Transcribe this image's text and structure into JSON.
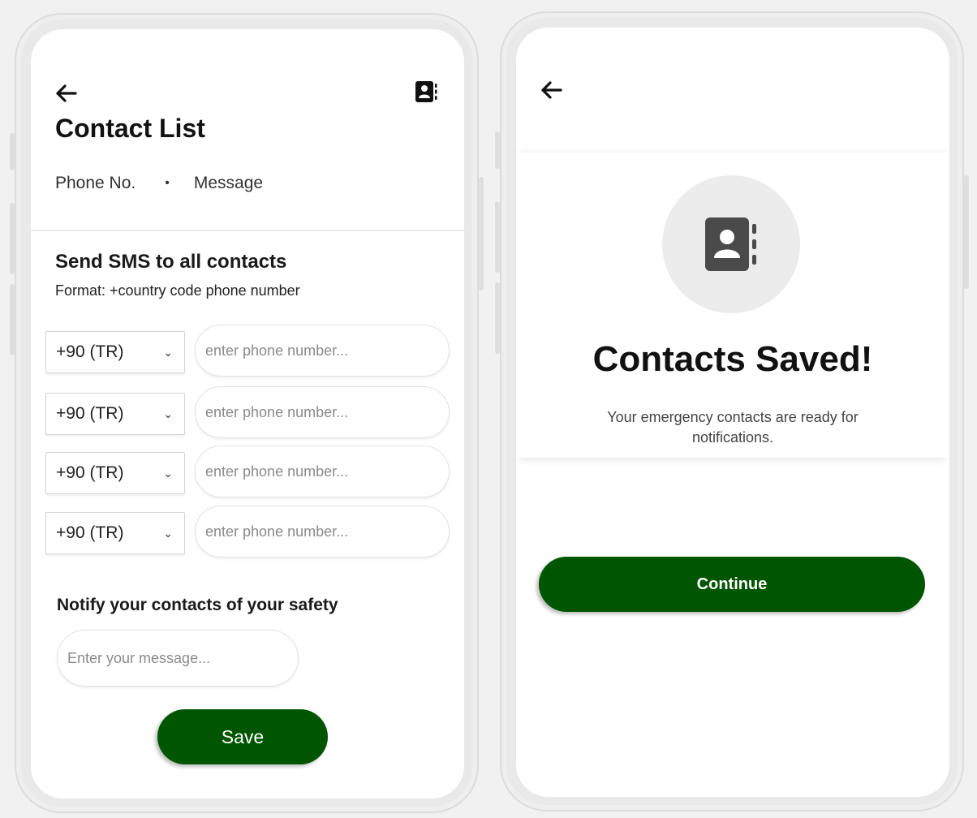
{
  "contact_list": {
    "title": "Contact List",
    "tabs": [
      "Phone No.",
      "Message"
    ],
    "tab_separator": "•",
    "section_title": "Send SMS to all contacts",
    "section_subtitle": "Format: +country code phone number",
    "rows": [
      {
        "country_code": "+90 (TR)",
        "phone_placeholder": "enter phone number..."
      },
      {
        "country_code": "+90 (TR)",
        "phone_placeholder": "enter phone number..."
      },
      {
        "country_code": "+90 (TR)",
        "phone_placeholder": "enter phone number..."
      },
      {
        "country_code": "+90 (TR)",
        "phone_placeholder": "enter phone number..."
      }
    ],
    "notify_title": "Notify your contacts of your safety",
    "message_placeholder": "Enter your message...",
    "save_label": "Save",
    "icons": {
      "back": "arrow-left-icon",
      "contacts": "address-book-icon"
    }
  },
  "saved_screen": {
    "title": "Contacts Saved!",
    "subtitle": "Your emergency contacts are ready for notifications.",
    "continue_label": "Continue",
    "icons": {
      "back": "arrow-left-icon",
      "contacts": "address-book-icon"
    }
  },
  "colors": {
    "primary_green": "#005500",
    "icon_dark": "#4a4a4a",
    "circle_bg": "#ececec"
  }
}
